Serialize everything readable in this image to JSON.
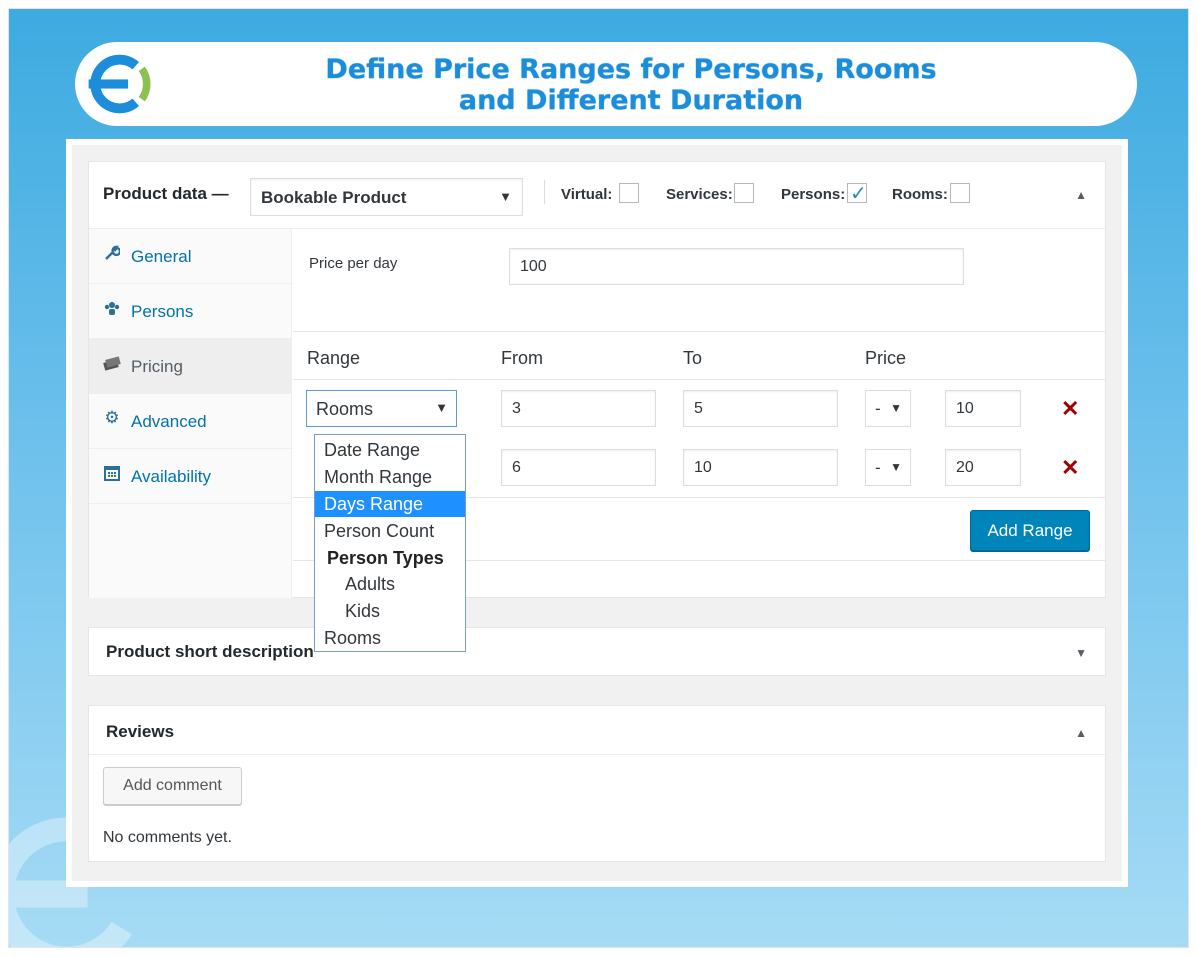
{
  "banner": {
    "title_line1": "Define Price Ranges for Persons, Rooms",
    "title_line2": "and Different Duration",
    "brand_color": "#1b8ddb",
    "accent_green": "#8cc152"
  },
  "product_data": {
    "label": "Product data —",
    "type_value": "Bookable Product",
    "checkboxes": [
      {
        "label": "Virtual:",
        "checked": false
      },
      {
        "label": "Services:",
        "checked": false
      },
      {
        "label": "Persons:",
        "checked": true
      },
      {
        "label": "Rooms:",
        "checked": false
      }
    ],
    "collapse_glyph": "▲"
  },
  "tabs": [
    {
      "label": "General",
      "icon": "wrench-icon",
      "glyph": "🔧"
    },
    {
      "label": "Persons",
      "icon": "persons-icon",
      "glyph": "👥"
    },
    {
      "label": "Pricing",
      "icon": "pricing-icon",
      "glyph": "💵",
      "active": true
    },
    {
      "label": "Advanced",
      "icon": "gear-icon",
      "glyph": "⚙"
    },
    {
      "label": "Availability",
      "icon": "calendar-icon",
      "glyph": "▦"
    }
  ],
  "pricing": {
    "price_per_day_label": "Price per day",
    "price_per_day_value": "100",
    "columns": [
      "Range",
      "From",
      "To",
      "Price"
    ],
    "rows": [
      {
        "range": "Rooms",
        "from": "3",
        "to": "5",
        "modifier": "-",
        "price": "10"
      },
      {
        "range": "",
        "from": "6",
        "to": "10",
        "modifier": "-",
        "price": "20"
      }
    ],
    "add_range_label": "Add Range",
    "delete_glyph": "✕"
  },
  "range_dropdown": {
    "options": [
      {
        "label": "Date Range",
        "kind": "item"
      },
      {
        "label": "Month Range",
        "kind": "item"
      },
      {
        "label": "Days Range",
        "kind": "item",
        "highlighted": true
      },
      {
        "label": "Person Count",
        "kind": "item"
      },
      {
        "label": "Person Types",
        "kind": "group"
      },
      {
        "label": "Adults",
        "kind": "sub"
      },
      {
        "label": "Kids",
        "kind": "sub"
      },
      {
        "label": "Rooms",
        "kind": "item"
      }
    ]
  },
  "short_description": {
    "title": "Product short description",
    "toggle_glyph": "▼"
  },
  "reviews": {
    "title": "Reviews",
    "toggle_glyph": "▲",
    "add_comment_label": "Add comment",
    "empty_text": "No comments yet."
  }
}
